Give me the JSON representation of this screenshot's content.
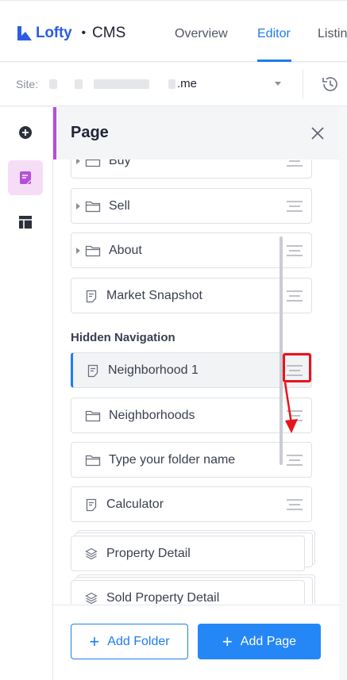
{
  "app": {
    "brand": "Lofty",
    "separator": "•",
    "product": "CMS"
  },
  "nav": {
    "tabs": [
      {
        "label": "Overview",
        "active": false
      },
      {
        "label": "Editor",
        "active": true
      },
      {
        "label": "Listin",
        "active": false
      }
    ]
  },
  "site": {
    "label": "Site:",
    "value": ".me"
  },
  "panel": {
    "title": "Page"
  },
  "tree": {
    "items": [
      {
        "label": "Buy",
        "kind": "folder",
        "expandable": true
      },
      {
        "label": "Sell",
        "kind": "folder",
        "expandable": true
      },
      {
        "label": "About",
        "kind": "folder",
        "expandable": true
      },
      {
        "label": "Market Snapshot",
        "kind": "page",
        "expandable": false
      }
    ],
    "hidden_section_title": "Hidden Navigation",
    "hidden_items": [
      {
        "label": "Neighborhood 1",
        "kind": "page",
        "selected": true
      },
      {
        "label": "Neighborhoods",
        "kind": "folder",
        "selected": false
      },
      {
        "label": "Type your folder name",
        "kind": "folder",
        "selected": false
      },
      {
        "label": "Calculator",
        "kind": "page",
        "selected": false
      },
      {
        "label": "Property Detail",
        "kind": "stack",
        "selected": false
      },
      {
        "label": "Sold Property Detail",
        "kind": "stack",
        "selected": false
      }
    ]
  },
  "footer": {
    "add_folder_label": "Add Folder",
    "add_page_label": "Add Page",
    "plus": "+"
  },
  "colors": {
    "brand": "#2b5ce6",
    "accent": "#1f7cf0",
    "panel_accent": "#b64fdb",
    "annotation": "#e8141c"
  }
}
